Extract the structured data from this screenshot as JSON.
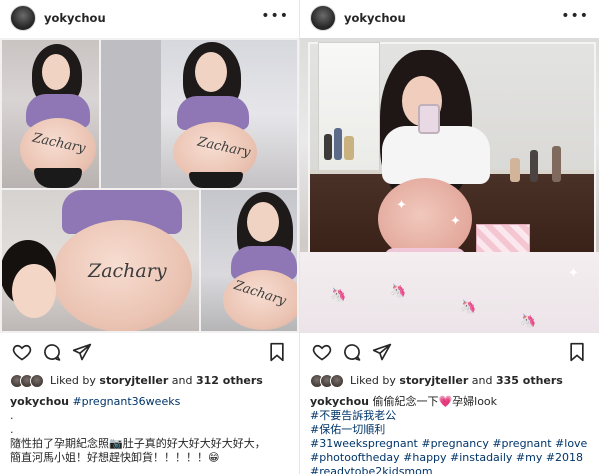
{
  "left_post": {
    "username": "yokychou",
    "more_icon": "more-horizontal-icon",
    "photo_words": [
      "Zachary",
      "Zachary",
      "Zachary",
      "Zachary"
    ],
    "liked_by_prefix": "Liked by",
    "liked_by_user": "storyjteller",
    "liked_by_and": "and",
    "liked_by_others": "312 others",
    "caption_user": "yokychou",
    "caption_tag": "#pregnant36weeks",
    "caption_dot1": ".",
    "caption_dot2": ".",
    "caption_line1": "隨性拍了孕期紀念照📷肚子真的好大好大好大好大，",
    "caption_line2": "簡直河馬小姐！好想趕快卸貨！！！！！😁"
  },
  "right_post": {
    "username": "yokychou",
    "more_icon": "more-horizontal-icon",
    "liked_by_prefix": "Liked by",
    "liked_by_user": "storyjteller",
    "liked_by_and": "and",
    "liked_by_others": "335 others",
    "caption_user": "yokychou",
    "caption_first": "偷偷紀念一下💗孕婦look",
    "caption_tags": [
      "#不要告訴我老公",
      "#保佑一切順利",
      "#31weekspregnant #pregnancy #pregnant #love",
      "#photooftheday #happy #instadaily #my #2018",
      "#readytobe2kidsmom"
    ]
  },
  "colors": {
    "text": "#262626",
    "hashtag": "#003569",
    "divider": "#e6e6e6"
  }
}
